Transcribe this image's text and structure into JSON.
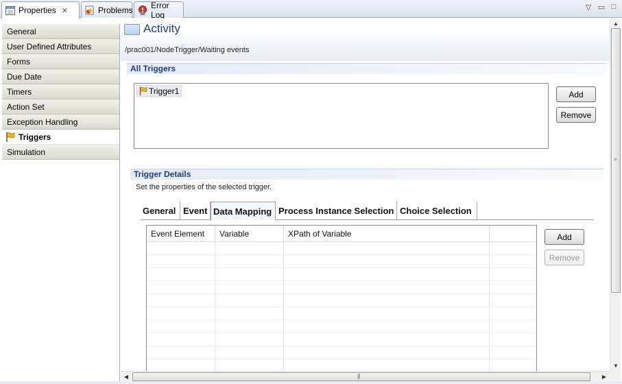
{
  "tabs": [
    {
      "label": "Properties",
      "icon": "properties-icon",
      "closeable": true
    },
    {
      "label": "Problems",
      "icon": "problems-icon"
    },
    {
      "label": "Error Log",
      "icon": "error-log-icon"
    }
  ],
  "window_controls": {
    "menu": "▽",
    "minimize": "▭",
    "maximize": "□"
  },
  "nav": {
    "items": [
      {
        "label": "General"
      },
      {
        "label": "User Defined Attributes"
      },
      {
        "label": "Forms"
      },
      {
        "label": "Due Date"
      },
      {
        "label": "Timers"
      },
      {
        "label": "Action Set"
      },
      {
        "label": "Exception Handling"
      },
      {
        "label": "Triggers",
        "active": true,
        "icon": "flag-icon"
      },
      {
        "label": "Simulation"
      }
    ]
  },
  "header": {
    "title": "Activity",
    "path": "/prac001/NodeTrigger/Waiting events"
  },
  "all_triggers": {
    "section_title": "All Triggers",
    "items": [
      "Trigger1"
    ],
    "add_label": "Add",
    "remove_label": "Remove"
  },
  "trigger_details": {
    "section_title": "Trigger Details",
    "subtitle": "Set the properties of the selected trigger.",
    "tabs": [
      {
        "label": "General"
      },
      {
        "label": "Event"
      },
      {
        "label": "Data Mapping",
        "active": true
      },
      {
        "label": "Process Instance Selection"
      },
      {
        "label": "Choice Selection"
      }
    ],
    "table": {
      "columns": [
        "Event Element",
        "Variable",
        "XPath of Variable",
        ""
      ],
      "rows": []
    },
    "add_label": "Add",
    "remove_label": "Remove",
    "remove_disabled": true
  },
  "colors": {
    "title_blue": "#1f3e7a",
    "nav_bg": "#dcdbd2",
    "flag_yellow": "#e8b820"
  }
}
